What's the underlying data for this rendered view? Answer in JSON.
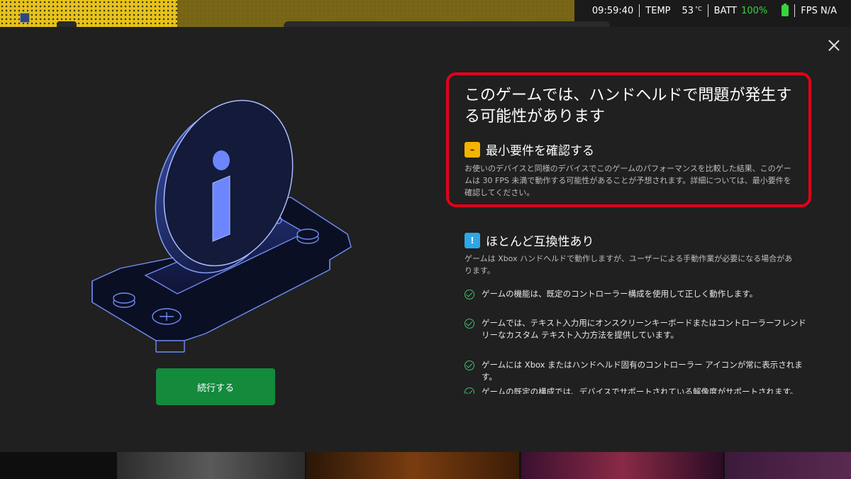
{
  "hud": {
    "time": "09:59:40",
    "temp_label": "TEMP",
    "temp_value": "53",
    "temp_unit": "°C",
    "batt_label": "BATT",
    "batt_value": "100%",
    "fps": "FPS N/A"
  },
  "dialog": {
    "title": "このゲームでは、ハンドヘルドで問題が発生する可能性があります",
    "section1": {
      "icon": "performance-warning-icon",
      "heading": "最小要件を確認する",
      "description": "お使いのデバイスと同様のデバイスでこのゲームのパフォーマンスを比較した結果、このゲームは 30 FPS 未満で動作する可能性があることが予想されます。詳細については、最小要件を確認してください。"
    },
    "section2": {
      "icon": "info-badge-icon",
      "heading": "ほとんど互換性あり",
      "description": "ゲームは Xbox ハンドヘルドで動作しますが、ユーザーによる手動作業が必要になる場合があります。",
      "checks": [
        "ゲームの機能は、既定のコントローラー構成を使用して正しく動作します。",
        "ゲームでは、テキスト入力用にオンスクリーンキーボードまたはコントローラーフレンドリーなカスタム テキスト入力方法を提供しています。",
        "ゲームには Xbox またはハンドヘルド固有のコントローラー アイコンが常に表示されます。",
        "ゲームの既定の構成では、デバイスでサポートされている解像度がサポートされます。"
      ]
    },
    "continue_label": "続行する"
  },
  "colors": {
    "accent_green": "#138a3c",
    "highlight_red": "#e3001b",
    "warn_yellow": "#f4b300",
    "info_blue": "#2ea6e8"
  }
}
